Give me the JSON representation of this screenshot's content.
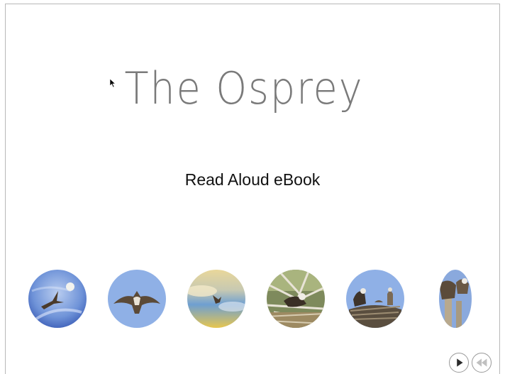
{
  "title": "The Osprey",
  "subtitle": "Read Aloud eBook",
  "thumbnails": [
    {
      "name": "osprey-flying-moon"
    },
    {
      "name": "osprey-overhead"
    },
    {
      "name": "osprey-sunset-sky"
    },
    {
      "name": "osprey-on-nest-branches"
    },
    {
      "name": "osprey-chicks-nest"
    },
    {
      "name": "osprey-perched-pole"
    }
  ],
  "colors": {
    "title": "#7a7a7a",
    "subtitle": "#111111",
    "sky_blue": "#8fb0e6",
    "frame": "#b8b8b8"
  },
  "controls": {
    "play_icon": "play-icon",
    "rewind_icon": "rewind-icon"
  }
}
